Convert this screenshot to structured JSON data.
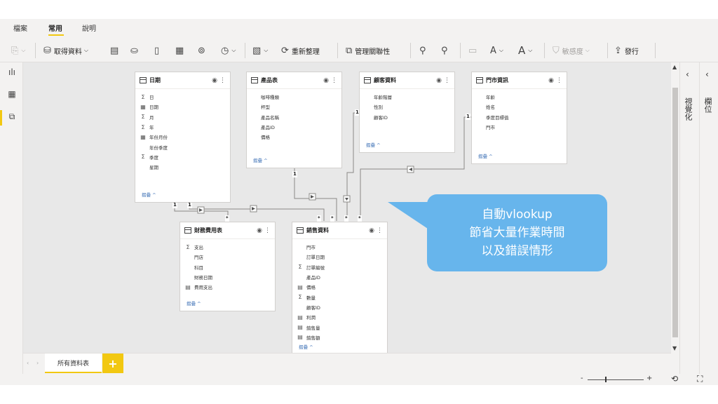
{
  "menu": {
    "file": "檔案",
    "home": "常用",
    "help": "說明"
  },
  "ribbon": {
    "get_data": "取得資料",
    "refresh": "重新整理",
    "manage_relationships": "管理關聯性",
    "font_size": "A",
    "sensitivity": "敏感度",
    "publish": "發行"
  },
  "right_panes": {
    "visualizations": "視覺化",
    "fields": "欄位"
  },
  "tables": {
    "date": {
      "name": "日期",
      "fields": [
        {
          "icon": "Σ",
          "label": "日"
        },
        {
          "icon": "▦",
          "label": "日期"
        },
        {
          "icon": "Σ",
          "label": "月"
        },
        {
          "icon": "Σ",
          "label": "年"
        },
        {
          "icon": "▦",
          "label": "年份月份"
        },
        {
          "icon": "",
          "label": "年份季度"
        },
        {
          "icon": "Σ",
          "label": "季度"
        },
        {
          "icon": "",
          "label": "星期"
        }
      ],
      "collapse": "摺疊 ^"
    },
    "product": {
      "name": "產品表",
      "fields": [
        {
          "icon": "",
          "label": "咖啡種類"
        },
        {
          "icon": "",
          "label": "杯型"
        },
        {
          "icon": "",
          "label": "產品名稱"
        },
        {
          "icon": "",
          "label": "產品ID"
        },
        {
          "icon": "",
          "label": "價格"
        }
      ],
      "collapse": "摺疊 ^"
    },
    "customer": {
      "name": "顧客資料",
      "fields": [
        {
          "icon": "",
          "label": "年齡階層"
        },
        {
          "icon": "",
          "label": "性別"
        },
        {
          "icon": "",
          "label": "顧客ID"
        }
      ],
      "collapse": "摺疊 ^"
    },
    "store": {
      "name": "門市資訊",
      "fields": [
        {
          "icon": "",
          "label": "年齡"
        },
        {
          "icon": "",
          "label": "姓名"
        },
        {
          "icon": "",
          "label": "季度目標值"
        },
        {
          "icon": "",
          "label": "門市"
        }
      ],
      "collapse": "摺疊 ^"
    },
    "finance": {
      "name": "財務費用表",
      "fields": [
        {
          "icon": "Σ",
          "label": "支出"
        },
        {
          "icon": "",
          "label": "門店"
        },
        {
          "icon": "",
          "label": "科目"
        },
        {
          "icon": "",
          "label": "財務日期"
        },
        {
          "icon": "▤",
          "label": "費用支出"
        }
      ],
      "collapse": "摺疊 ^"
    },
    "sales": {
      "name": "銷售資料",
      "fields": [
        {
          "icon": "",
          "label": "門市"
        },
        {
          "icon": "",
          "label": "訂單日期"
        },
        {
          "icon": "Σ",
          "label": "訂單編號"
        },
        {
          "icon": "",
          "label": "產品ID"
        },
        {
          "icon": "▤",
          "label": "價格"
        },
        {
          "icon": "Σ",
          "label": "數量"
        },
        {
          "icon": "",
          "label": "顧客ID"
        },
        {
          "icon": "▤",
          "label": "利潤"
        },
        {
          "icon": "▤",
          "label": "銷售量"
        },
        {
          "icon": "▤",
          "label": "銷售額"
        }
      ],
      "collapse": "摺疊 ^"
    }
  },
  "cardinality": {
    "one": "1",
    "many": "*"
  },
  "callout": {
    "line1": "自動vlookup",
    "line2": "節省大量作業時間",
    "line3": "以及錯誤情形"
  },
  "tab": {
    "all_tables": "所有資料表",
    "add": "+"
  },
  "status": {
    "zoom_minus": "-",
    "zoom_plus": "+"
  },
  "colors": {
    "accent": "#f2c811",
    "callout": "#67b5ec",
    "link": "#3b6fb5"
  }
}
